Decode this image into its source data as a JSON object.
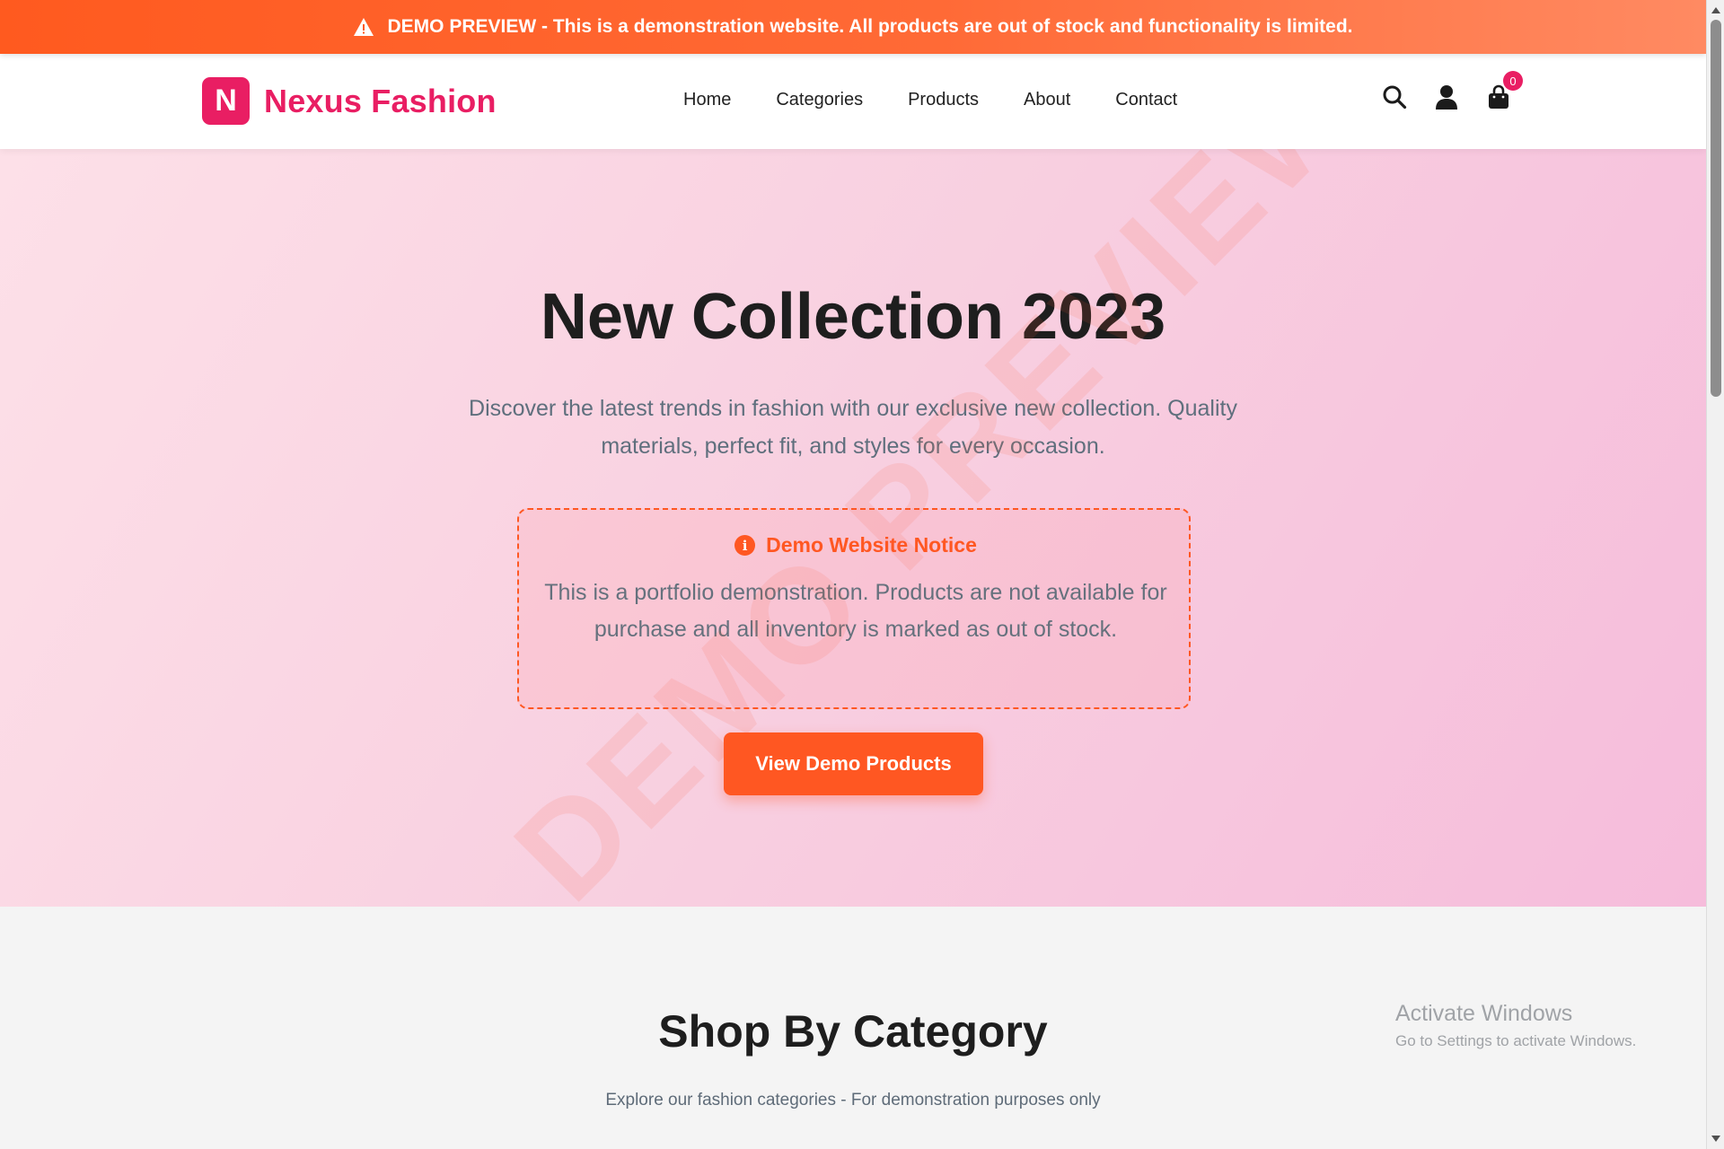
{
  "banner": {
    "text": "DEMO PREVIEW - This is a demonstration website. All products are out of stock and functionality is limited.",
    "icon": "warning-icon"
  },
  "header": {
    "logo_letter": "N",
    "brand": "Nexus Fashion",
    "nav": [
      "Home",
      "Categories",
      "Products",
      "About",
      "Contact"
    ],
    "cart_count": "0",
    "icons": [
      "search-icon",
      "user-icon",
      "shopping-bag-icon"
    ]
  },
  "hero": {
    "title": "New Collection 2023",
    "description": "Discover the latest trends in fashion with our exclusive new collection. Quality materials, perfect fit, and styles for every occasion.",
    "notice_title": "Demo Website Notice",
    "notice_body": "This is a portfolio demonstration. Products are not available for purchase and all inventory is marked as out of stock.",
    "cta_label": "View Demo Products",
    "watermark": "DEMO PREVIEW"
  },
  "categories": {
    "title": "Shop By Category",
    "subtitle": "Explore our fashion categories - For demonstration purposes only"
  },
  "os_overlay": {
    "line1": "Activate Windows",
    "line2": "Go to Settings to activate Windows."
  },
  "colors": {
    "accent": "#e91e63",
    "cta": "#ff5722",
    "banner": "#ff5a1f"
  }
}
